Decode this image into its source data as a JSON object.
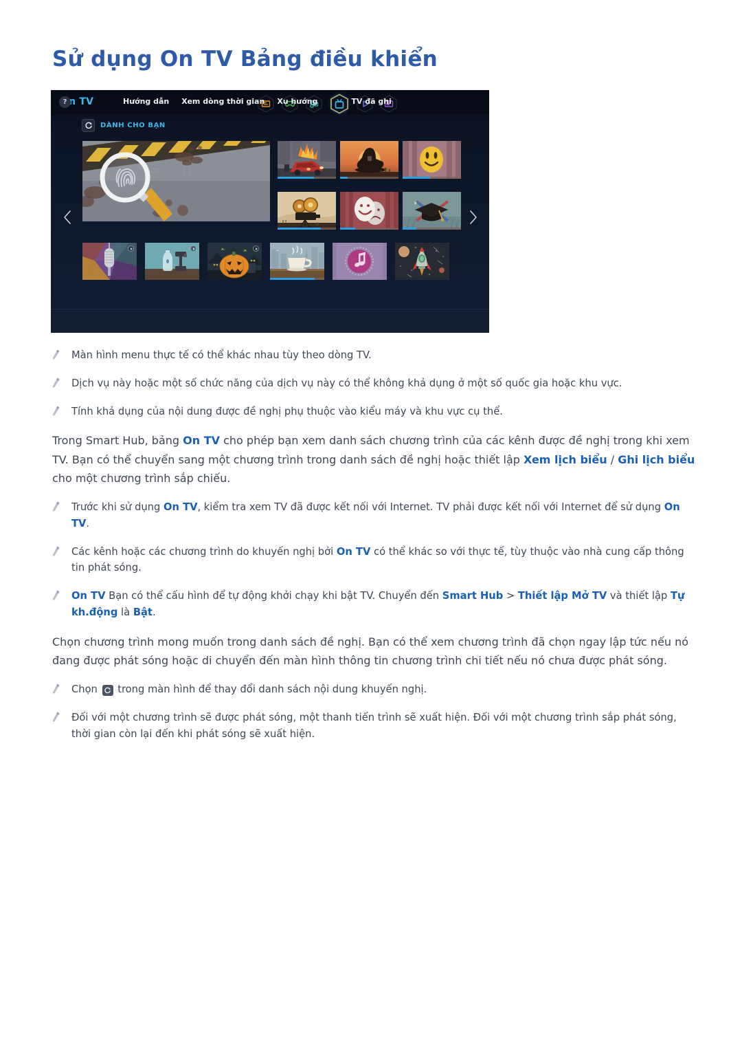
{
  "page": {
    "title": "Sử dụng On TV Bảng điều khiển"
  },
  "tv_panel": {
    "logo": "On TV",
    "section_label": "DÀNH CHO BẠN",
    "refresh_icon": "refresh-icon",
    "left_arrow_icon": "chevron-left-icon",
    "right_arrow_icon": "chevron-right-icon",
    "help_icon_label": "?",
    "hex_icons": [
      {
        "name": "news-icon",
        "color": "#d89022",
        "selected": false
      },
      {
        "name": "games-icon",
        "color": "#3fbf5c",
        "selected": false
      },
      {
        "name": "apps-icon",
        "color": "#2fb7a8",
        "selected": false
      },
      {
        "name": "on-tv-icon",
        "color": "#3fb7e8",
        "selected": true
      },
      {
        "name": "play-icon",
        "color": "#6b76d8",
        "selected": false
      },
      {
        "name": "multi-window-icon",
        "color": "#9a56c8",
        "selected": false
      }
    ],
    "bottom_links": [
      {
        "label": "Hướng dẫn",
        "divider_after": false
      },
      {
        "label": "Xem dòng thời gian",
        "divider_after": false
      },
      {
        "label": "Xu hướng",
        "divider_after": true
      },
      {
        "label": "TV đã ghi",
        "divider_after": false
      }
    ],
    "tiles": {
      "featured": {
        "name": "tile-crime-scene",
        "progress": null
      },
      "grid": [
        {
          "name": "tile-car-explosion",
          "progress": 62
        },
        {
          "name": "tile-western-hat",
          "progress": 13
        },
        {
          "name": "tile-smiley-comedy",
          "progress": 47
        },
        {
          "name": "tile-film-camera",
          "progress": 74
        },
        {
          "name": "tile-drama-masks",
          "progress": 26
        },
        {
          "name": "tile-graduation-cap",
          "progress": 23
        }
      ],
      "bottom_row": [
        {
          "name": "tile-microphone",
          "progress": null,
          "badge": true
        },
        {
          "name": "tile-fitness-bottle",
          "progress": null,
          "badge": true
        },
        {
          "name": "tile-halloween-pumpkin",
          "progress": null,
          "badge": true
        },
        {
          "name": "tile-coffee-cup",
          "progress": 82,
          "badge": false
        },
        {
          "name": "tile-music-note",
          "progress": null,
          "badge": false
        },
        {
          "name": "tile-rocket-space",
          "progress": null,
          "badge": false
        }
      ]
    }
  },
  "notes_top": [
    "Màn hình menu thực tế có thể khác nhau tùy theo dòng TV.",
    "Dịch vụ này hoặc một số chức năng của dịch vụ này có thể không khả dụng ở một số quốc gia hoặc khu vực.",
    "Tính khả dụng của nội dung được đề nghị phụ thuộc vào kiểu máy và khu vực cụ thể."
  ],
  "paragraph_1": {
    "p1": "Trong Smart Hub, bảng ",
    "b1": "On TV",
    "p2": " cho phép bạn xem danh sách chương trình của các kênh được đề nghị trong khi xem TV. Bạn có thể chuyển sang một chương trình trong danh sách đề nghị hoặc thiết lập ",
    "b2": "Xem lịch biểu",
    "sep": " / ",
    "b3": "Ghi lịch biểu",
    "p3": " cho một chương trình sắp chiếu."
  },
  "notes_mid": {
    "note1": {
      "p1": "Trước khi sử dụng ",
      "b1": "On TV",
      "p2": ", kiểm tra xem TV đã được kết nối với Internet. TV phải được kết nối với Internet để sử dụng ",
      "b2": "On TV",
      "p3": "."
    },
    "note2": {
      "p1": "Các kênh hoặc các chương trình do khuyến nghị bởi ",
      "b1": "On TV",
      "p2": " có thể khác so với thực tế, tùy thuộc vào nhà cung cấp thông tin phát sóng."
    },
    "note3": {
      "b1": "On TV",
      "p1": " Bạn có thể cấu hình để tự động khởi chạy khi bật TV. Chuyển đến ",
      "b2": "Smart Hub",
      "p2": " > ",
      "b3": "Thiết lập Mở TV",
      "p3": " và thiết lập ",
      "b4": "Tự kh.động",
      "p4": " là ",
      "b5": "Bật",
      "p5": "."
    }
  },
  "paragraph_2": "Chọn chương trình mong muốn trong danh sách đề nghị. Bạn có thể xem chương trình đã chọn ngay lập tức nếu nó đang được phát sóng hoặc di chuyển đến màn hình thông tin chương trình chi tiết nếu nó chưa được phát sóng.",
  "notes_bottom": {
    "note1": {
      "p1": "Chọn ",
      "icon": "refresh-icon",
      "p2": " trong màn hình để thay đổi danh sách nội dung khuyến nghị."
    },
    "note2": "Đối với một chương trình sẽ được phát sóng, một thanh tiến trình sẽ xuất hiện. Đối với một chương trình sắp phát sóng, thời gian còn lại đến khi phát sóng sẽ xuất hiện."
  },
  "colors": {
    "title_blue": "#2e5aa8",
    "link_blue": "#1a5fb4",
    "accent_cyan": "#3fb7e8",
    "progress_blue": "#2d9fe0",
    "panel_bg": "#0d1628"
  }
}
